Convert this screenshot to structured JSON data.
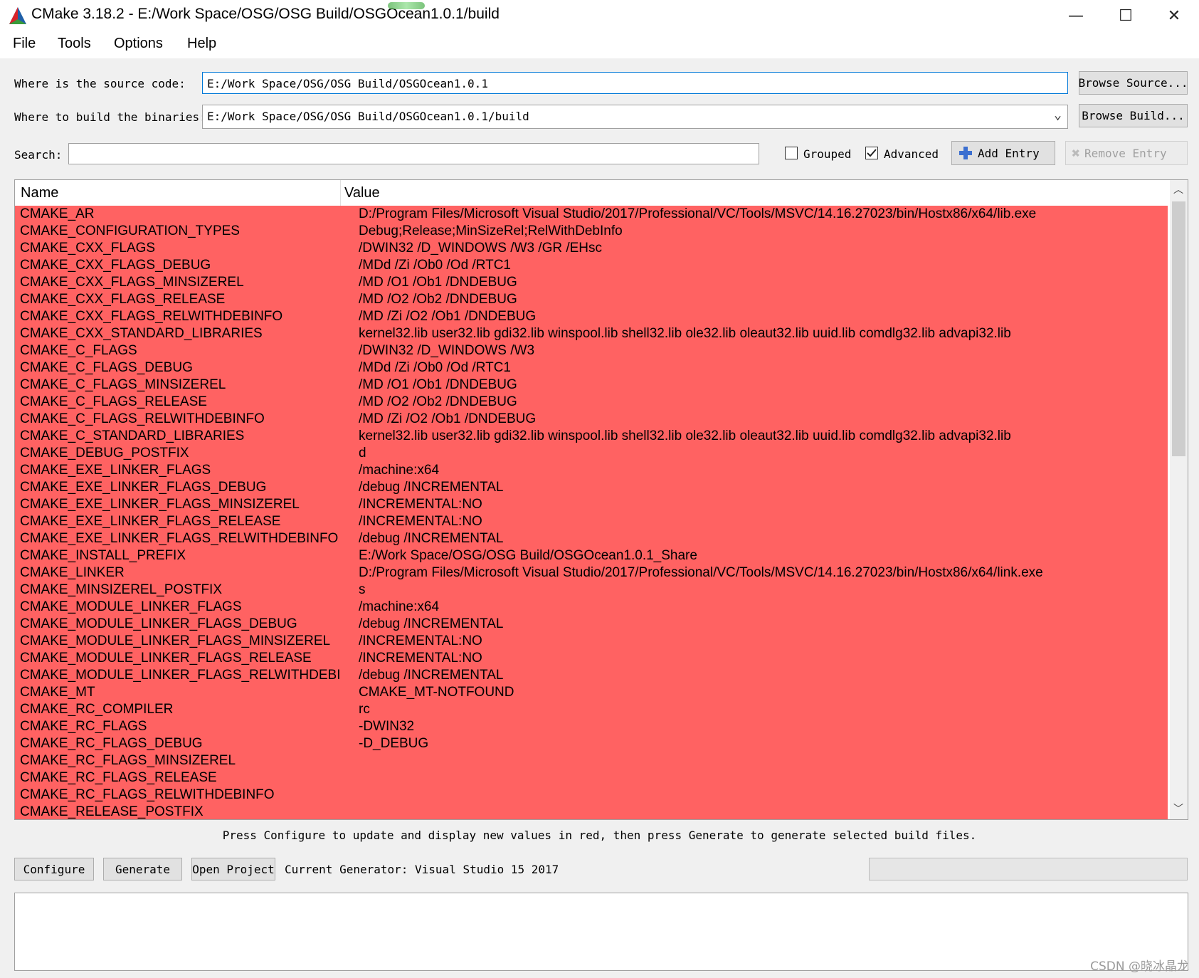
{
  "window": {
    "title": "CMake 3.18.2 - E:/Work Space/OSG/OSG Build/OSGOcean1.0.1/build",
    "minimize_glyph": "—",
    "maximize_glyph": "☐",
    "close_glyph": "✕"
  },
  "menu": [
    "File",
    "Tools",
    "Options",
    "Help"
  ],
  "source": {
    "label": "Where is the source code:",
    "value": "E:/Work Space/OSG/OSG Build/OSGOcean1.0.1",
    "button": "Browse Source..."
  },
  "build": {
    "label": "Where to build the binaries:",
    "value": "E:/Work Space/OSG/OSG Build/OSGOcean1.0.1/build",
    "button": "Browse Build..."
  },
  "search": {
    "label": "Search:",
    "value": ""
  },
  "grouped": {
    "label": "Grouped",
    "checked": false
  },
  "advanced": {
    "label": "Advanced",
    "checked": true
  },
  "add_entry": "Add Entry",
  "remove_entry": "Remove Entry",
  "table": {
    "headers": {
      "name": "Name",
      "value": "Value"
    },
    "row_color": "#ff6262",
    "rows": [
      {
        "name": "CMAKE_AR",
        "value": "D:/Program Files/Microsoft Visual Studio/2017/Professional/VC/Tools/MSVC/14.16.27023/bin/Hostx86/x64/lib.exe"
      },
      {
        "name": "CMAKE_CONFIGURATION_TYPES",
        "value": "Debug;Release;MinSizeRel;RelWithDebInfo"
      },
      {
        "name": "CMAKE_CXX_FLAGS",
        "value": "/DWIN32 /D_WINDOWS /W3 /GR /EHsc"
      },
      {
        "name": "CMAKE_CXX_FLAGS_DEBUG",
        "value": "/MDd /Zi /Ob0 /Od /RTC1"
      },
      {
        "name": "CMAKE_CXX_FLAGS_MINSIZEREL",
        "value": "/MD /O1 /Ob1 /DNDEBUG"
      },
      {
        "name": "CMAKE_CXX_FLAGS_RELEASE",
        "value": "/MD /O2 /Ob2 /DNDEBUG"
      },
      {
        "name": "CMAKE_CXX_FLAGS_RELWITHDEBINFO",
        "value": "/MD /Zi /O2 /Ob1 /DNDEBUG"
      },
      {
        "name": "CMAKE_CXX_STANDARD_LIBRARIES",
        "value": "kernel32.lib user32.lib gdi32.lib winspool.lib shell32.lib ole32.lib oleaut32.lib uuid.lib comdlg32.lib advapi32.lib"
      },
      {
        "name": "CMAKE_C_FLAGS",
        "value": "/DWIN32 /D_WINDOWS /W3"
      },
      {
        "name": "CMAKE_C_FLAGS_DEBUG",
        "value": "/MDd /Zi /Ob0 /Od /RTC1"
      },
      {
        "name": "CMAKE_C_FLAGS_MINSIZEREL",
        "value": "/MD /O1 /Ob1 /DNDEBUG"
      },
      {
        "name": "CMAKE_C_FLAGS_RELEASE",
        "value": "/MD /O2 /Ob2 /DNDEBUG"
      },
      {
        "name": "CMAKE_C_FLAGS_RELWITHDEBINFO",
        "value": "/MD /Zi /O2 /Ob1 /DNDEBUG"
      },
      {
        "name": "CMAKE_C_STANDARD_LIBRARIES",
        "value": "kernel32.lib user32.lib gdi32.lib winspool.lib shell32.lib ole32.lib oleaut32.lib uuid.lib comdlg32.lib advapi32.lib"
      },
      {
        "name": "CMAKE_DEBUG_POSTFIX",
        "value": "d"
      },
      {
        "name": "CMAKE_EXE_LINKER_FLAGS",
        "value": "/machine:x64"
      },
      {
        "name": "CMAKE_EXE_LINKER_FLAGS_DEBUG",
        "value": "/debug /INCREMENTAL"
      },
      {
        "name": "CMAKE_EXE_LINKER_FLAGS_MINSIZEREL",
        "value": "/INCREMENTAL:NO"
      },
      {
        "name": "CMAKE_EXE_LINKER_FLAGS_RELEASE",
        "value": "/INCREMENTAL:NO"
      },
      {
        "name": "CMAKE_EXE_LINKER_FLAGS_RELWITHDEBINFO",
        "value": "/debug /INCREMENTAL"
      },
      {
        "name": "CMAKE_INSTALL_PREFIX",
        "value": "E:/Work Space/OSG/OSG Build/OSGOcean1.0.1_Share"
      },
      {
        "name": "CMAKE_LINKER",
        "value": "D:/Program Files/Microsoft Visual Studio/2017/Professional/VC/Tools/MSVC/14.16.27023/bin/Hostx86/x64/link.exe"
      },
      {
        "name": "CMAKE_MINSIZEREL_POSTFIX",
        "value": "s"
      },
      {
        "name": "CMAKE_MODULE_LINKER_FLAGS",
        "value": "/machine:x64"
      },
      {
        "name": "CMAKE_MODULE_LINKER_FLAGS_DEBUG",
        "value": "/debug /INCREMENTAL"
      },
      {
        "name": "CMAKE_MODULE_LINKER_FLAGS_MINSIZEREL",
        "value": "/INCREMENTAL:NO"
      },
      {
        "name": "CMAKE_MODULE_LINKER_FLAGS_RELEASE",
        "value": "/INCREMENTAL:NO"
      },
      {
        "name": "CMAKE_MODULE_LINKER_FLAGS_RELWITHDEBIN...",
        "value": "/debug /INCREMENTAL"
      },
      {
        "name": "CMAKE_MT",
        "value": "CMAKE_MT-NOTFOUND"
      },
      {
        "name": "CMAKE_RC_COMPILER",
        "value": "rc"
      },
      {
        "name": "CMAKE_RC_FLAGS",
        "value": "-DWIN32"
      },
      {
        "name": "CMAKE_RC_FLAGS_DEBUG",
        "value": "-D_DEBUG"
      },
      {
        "name": "CMAKE_RC_FLAGS_MINSIZEREL",
        "value": ""
      },
      {
        "name": "CMAKE_RC_FLAGS_RELEASE",
        "value": ""
      },
      {
        "name": "CMAKE_RC_FLAGS_RELWITHDEBINFO",
        "value": ""
      },
      {
        "name": "CMAKE_RELEASE_POSTFIX",
        "value": ""
      }
    ]
  },
  "hint": "Press Configure to update and display new values in red, then press Generate to generate selected build files.",
  "configure": "Configure",
  "generate": "Generate",
  "open_project": "Open Project",
  "generator": "Current Generator: Visual Studio 15 2017",
  "watermark": "CSDN @晓冰晶龙"
}
